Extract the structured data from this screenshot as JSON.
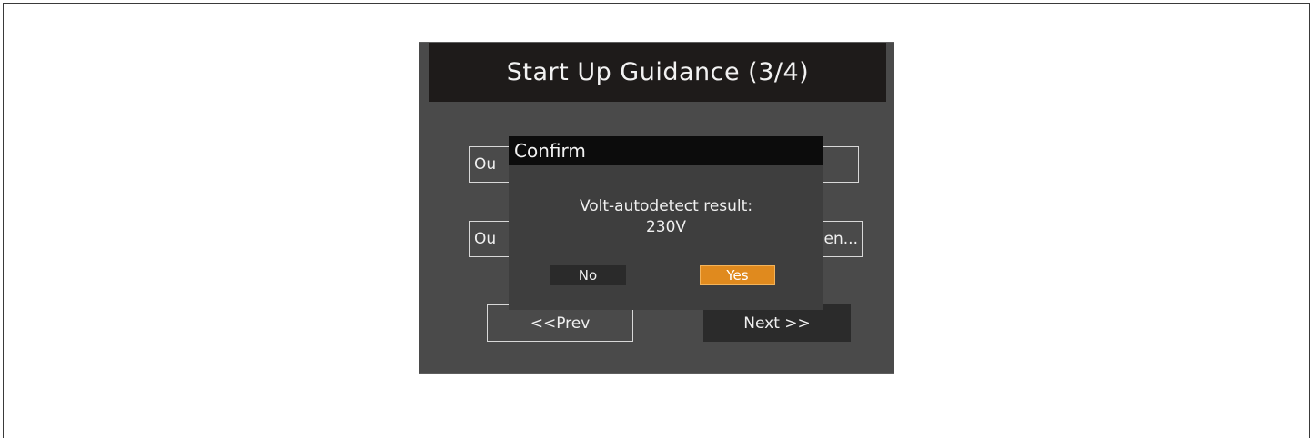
{
  "screen": {
    "title": "Start Up Guidance (3/4)",
    "option1_label": "Ou",
    "option2_label": "Ou",
    "option2_tail": "en...",
    "prev_label": "<<Prev",
    "next_label": "Next >>"
  },
  "dialog": {
    "title": "Confirm",
    "message_line1": "Volt-autodetect result:",
    "message_line2": "230V",
    "no_label": "No",
    "yes_label": "Yes"
  },
  "colors": {
    "panel_bg": "#4a4a4a",
    "header_bg": "#1e1b1a",
    "dialog_bg": "#3e3e3e",
    "dialog_title_bg": "#0c0c0c",
    "accent_yes": "#e08a1e"
  }
}
